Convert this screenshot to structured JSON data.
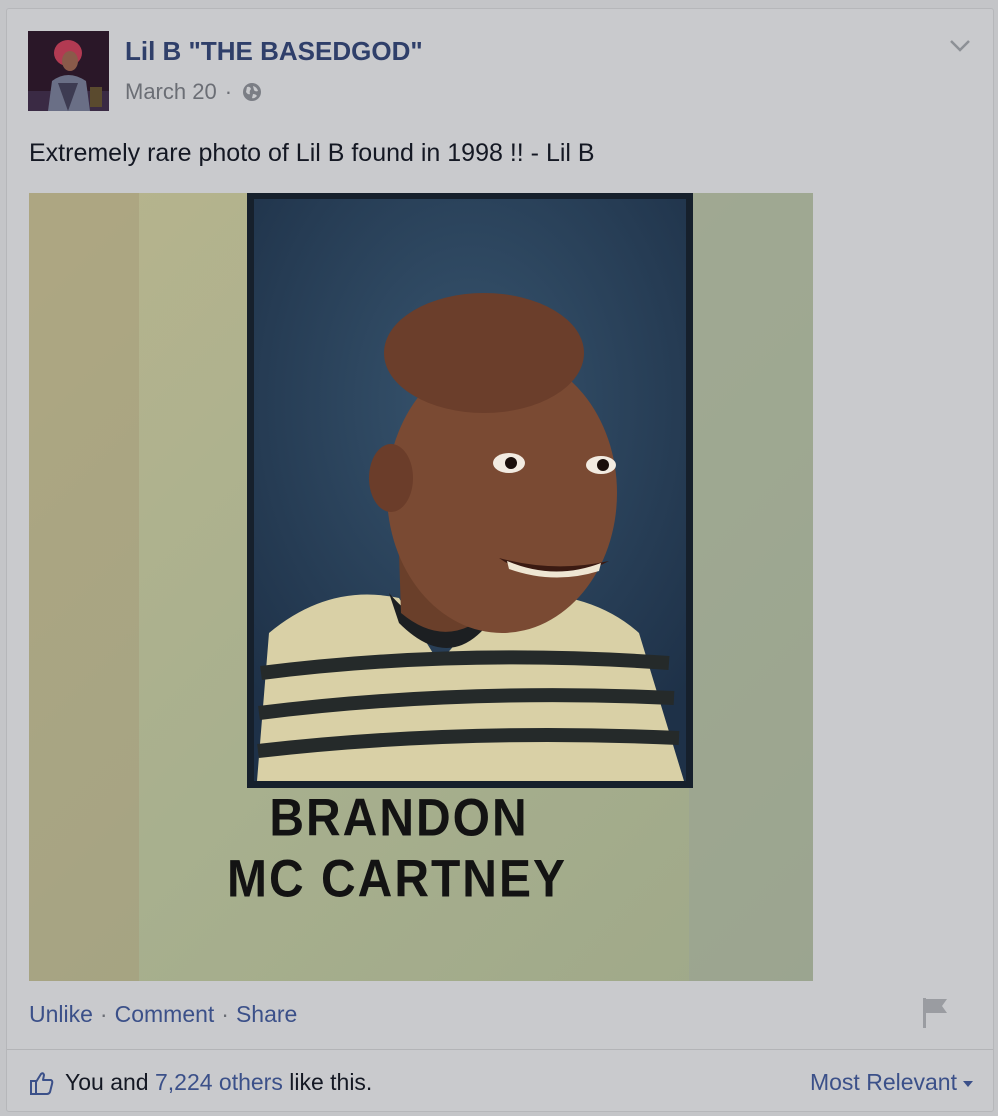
{
  "post": {
    "author": "Lil B \"THE BASEDGOD\"",
    "date": "March 20",
    "date_separator": "·",
    "privacy_icon": "globe-icon",
    "text": "Extremely rare photo of Lil B found in 1998 !! - Lil B",
    "photo_caption_line1": "BRANDON",
    "photo_caption_line2": "MC CARTNEY"
  },
  "actions": {
    "unlike": "Unlike",
    "comment": "Comment",
    "share": "Share",
    "separator": "·"
  },
  "likes": {
    "prefix": "You and ",
    "others_link": "7,224 others",
    "suffix": " like this.",
    "sort_label": "Most Relevant"
  },
  "colors": {
    "link": "#3b5089",
    "author": "#2f3f6a",
    "background": "#c9cacd"
  }
}
